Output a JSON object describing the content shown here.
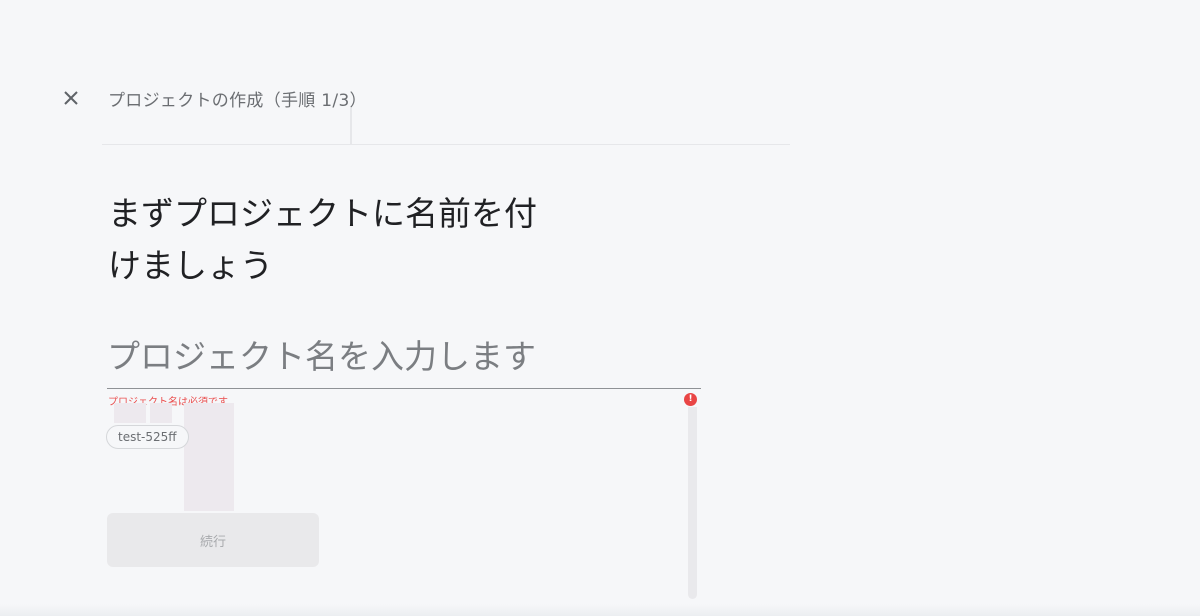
{
  "header": {
    "close_icon": "close-icon",
    "title": "プロジェクトの作成（手順 1/3）"
  },
  "main": {
    "headline_line1": "まずプロジェクトに名前を付",
    "headline_line2": "けましょう",
    "project_name_input": {
      "value": "",
      "placeholder": "プロジェクト名を入力します"
    },
    "error_message": "プロジェクト名は必須です",
    "error_icon": "alert-icon",
    "suggestion_chip": "test-525ff",
    "continue_label": "続行"
  },
  "colors": {
    "error": "#ea4f4f",
    "background": "#f6f7f9",
    "disabled_button": "#e9e9eb"
  }
}
